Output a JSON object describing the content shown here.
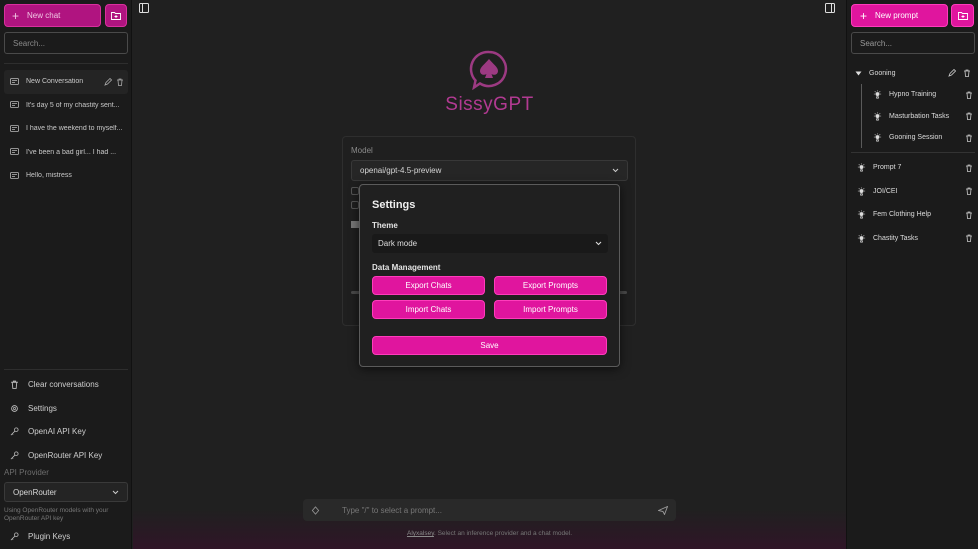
{
  "left_sidebar": {
    "new_chat_label": "New chat",
    "search_placeholder": "Search...",
    "conversations": [
      "New Conversation",
      "It's day 5 of my chastity sent...",
      "I have the weekend to myself...",
      "I've been a bad girl... I had ...",
      "Hello, mistress"
    ],
    "bottom_items": [
      {
        "label": "Clear conversations",
        "icon": "trash-icon"
      },
      {
        "label": "Settings",
        "icon": "gear-icon"
      },
      {
        "label": "OpenAI API Key",
        "icon": "key-icon"
      },
      {
        "label": "OpenRouter API Key",
        "icon": "key-icon"
      }
    ],
    "api_provider_label": "API Provider",
    "api_provider_value": "OpenRouter",
    "provider_note": "Using OpenRouter models with your OpenRouter API key",
    "plugin_keys_label": "Plugin Keys"
  },
  "main": {
    "app_title": "SissyGPT",
    "model_label": "Model",
    "model_value": "openai/gpt-4.5-preview",
    "chat_placeholder": "Type \"/\" to select a prompt...",
    "footer_link": "Alyxalsey",
    "footer_text": ". Select an inference provider and a chat model.",
    "accent_color": "#b23a92"
  },
  "settings_modal": {
    "title": "Settings",
    "theme_label": "Theme",
    "theme_value": "Dark mode",
    "data_label": "Data Management",
    "export_chats": "Export Chats",
    "export_prompts": "Export Prompts",
    "import_chats": "Import Chats",
    "import_prompts": "Import Prompts",
    "save": "Save"
  },
  "right_sidebar": {
    "new_prompt_label": "New prompt",
    "search_placeholder": "Search...",
    "folder_name": "Gooning",
    "folder_prompts": [
      "Hypno Training",
      "Masturbation Tasks",
      "Gooning Session"
    ],
    "prompts": [
      "Prompt 7",
      "JOI/CEI",
      "Fem Clothing Help",
      "Chastity Tasks"
    ]
  },
  "colors": {
    "brand_pink": "#e0159e",
    "background": "#202020",
    "sidebar_bg": "#1b1b1b"
  }
}
